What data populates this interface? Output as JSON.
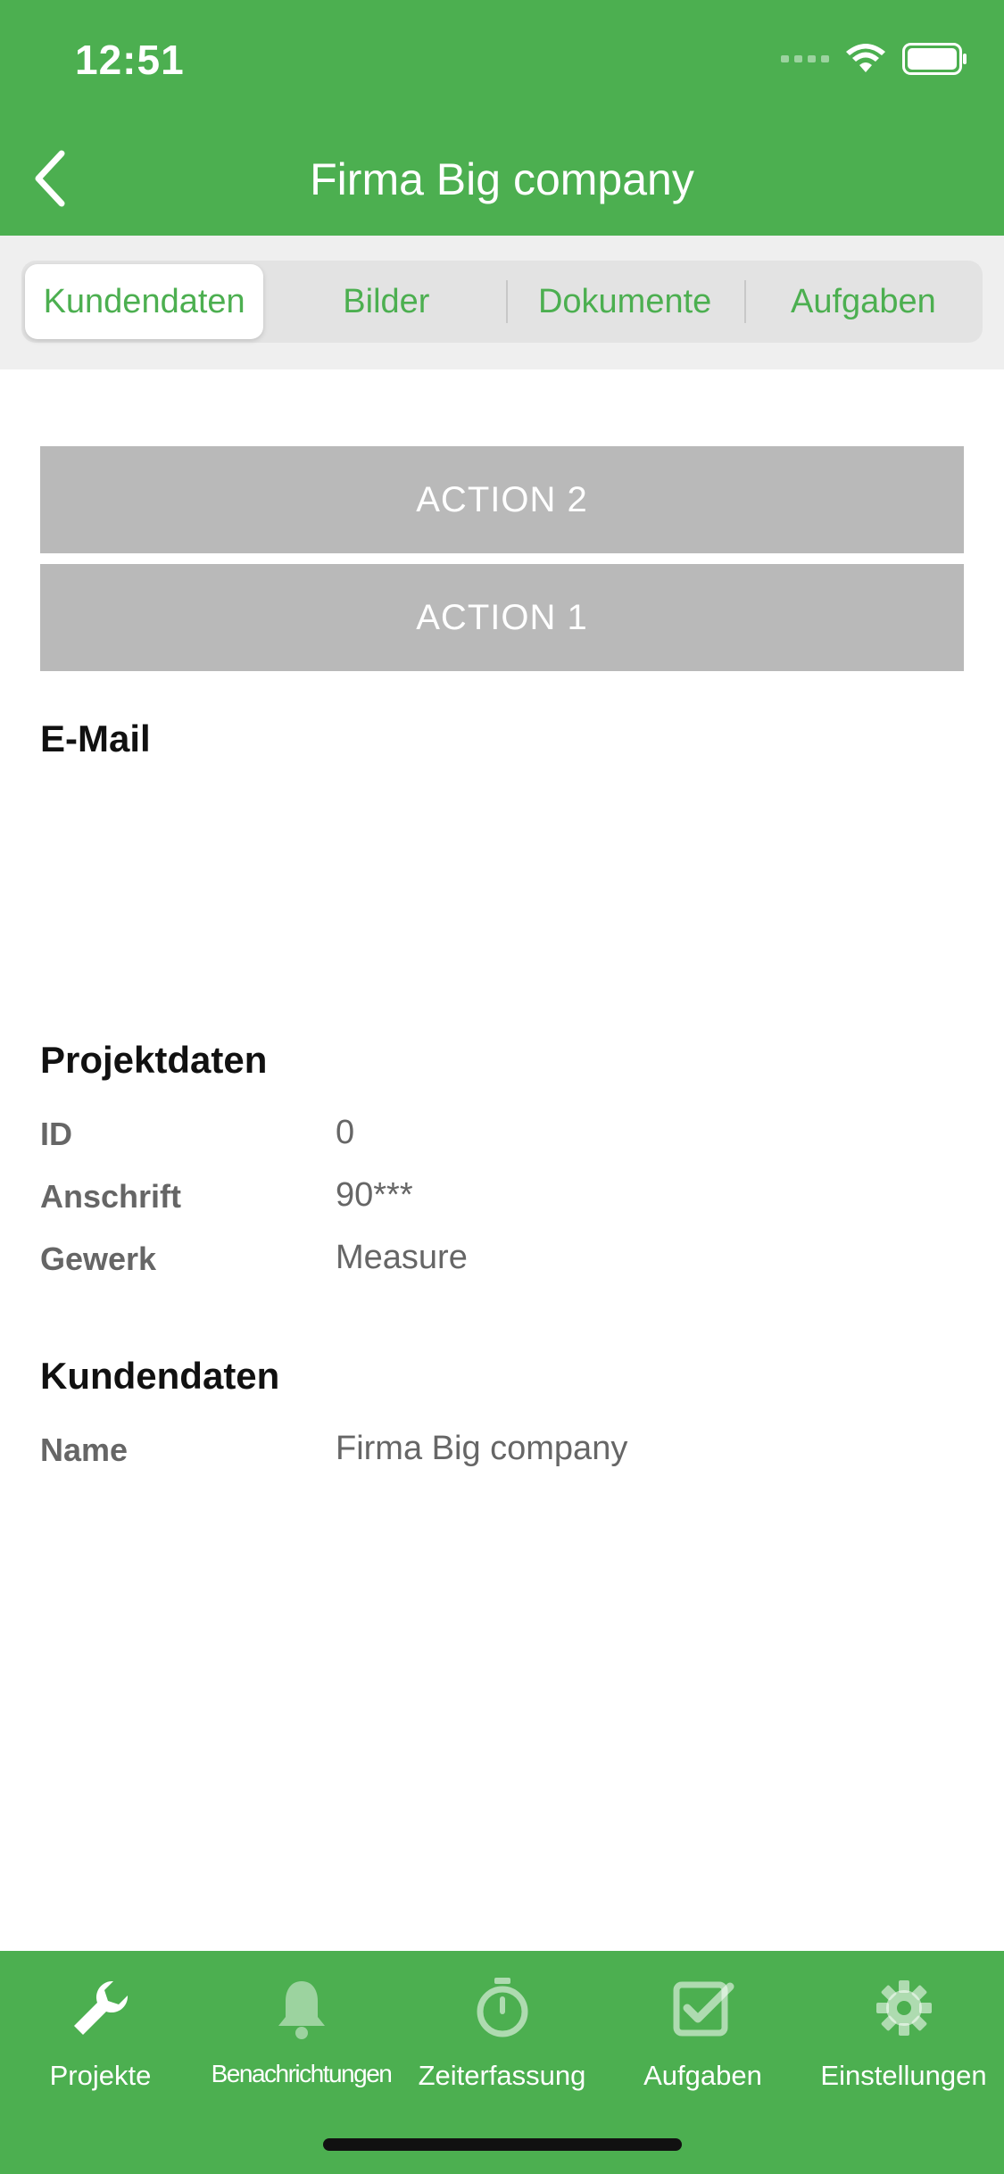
{
  "status": {
    "time": "12:51"
  },
  "nav": {
    "title": "Firma Big company"
  },
  "segments": [
    "Kundendaten",
    "Bilder",
    "Dokumente",
    "Aufgaben"
  ],
  "actions": {
    "action2": "ACTION 2",
    "action1": "ACTION 1"
  },
  "email": {
    "heading": "E-Mail"
  },
  "projekt": {
    "heading": "Projektdaten",
    "rows": [
      {
        "label": "ID",
        "value": "0"
      },
      {
        "label": "Anschrift",
        "value": "90***"
      },
      {
        "label": "Gewerk",
        "value": "Measure"
      }
    ]
  },
  "kunde": {
    "heading": "Kundendaten",
    "rows": [
      {
        "label": "Name",
        "value": "Firma Big company"
      }
    ]
  },
  "tabs": [
    {
      "label": "Projekte",
      "icon": "wrench-icon"
    },
    {
      "label": "Benachrichtungen",
      "icon": "bell-icon"
    },
    {
      "label": "Zeiterfassung",
      "icon": "stopwatch-icon"
    },
    {
      "label": "Aufgaben",
      "icon": "checkbox-icon"
    },
    {
      "label": "Einstellungen",
      "icon": "gear-icon"
    }
  ],
  "colors": {
    "accent": "#4caf50",
    "button": "#b9b9b9"
  }
}
